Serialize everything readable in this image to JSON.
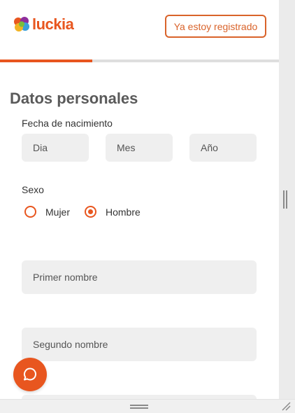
{
  "header": {
    "logo_text": "luckia",
    "login_button": "Ya estoy registrado"
  },
  "progress": {
    "fraction": 0.33,
    "color": "#e8561f"
  },
  "form": {
    "section_title": "Datos personales",
    "birth_label": "Fecha de nacimiento",
    "day_placeholder": "Dia",
    "month_placeholder": "Mes",
    "year_placeholder": "Año",
    "sex_label": "Sexo",
    "sex_options": [
      {
        "label": "Mujer",
        "selected": false
      },
      {
        "label": "Hombre",
        "selected": true
      }
    ],
    "first_name_placeholder": "Primer nombre",
    "second_name_placeholder": "Segundo nombre"
  },
  "icons": {
    "logo": "clover-logo-icon",
    "chat": "chat-bubble-icon",
    "resize": "resize-corner-icon"
  },
  "colors": {
    "accent": "#e8561f",
    "field_bg": "#efefef"
  }
}
